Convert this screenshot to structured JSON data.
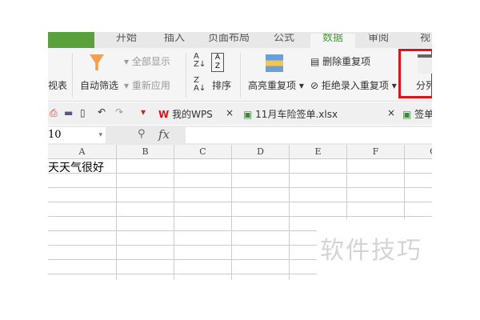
{
  "tabs": [
    "开始",
    "插入",
    "页面布局",
    "公式",
    "数据",
    "审阅",
    "视"
  ],
  "ribbon": {
    "pivot_tail": "视表",
    "autofilter": "自动筛选",
    "show_all": "全部显示",
    "reapply": "重新应用",
    "sort": "排序",
    "highlight_dup": "高亮重复项",
    "remove_dup": "删除重复项",
    "reject_dup": "拒绝录入重复项",
    "split_col": "分列"
  },
  "doc_tabs": [
    {
      "label": "我的WPS"
    },
    {
      "label": "11月车险签单.xlsx"
    },
    {
      "label": "签单"
    }
  ],
  "formula_bar": {
    "name_box": "10",
    "fx": "fx",
    "value": ""
  },
  "columns": [
    "A",
    "B",
    "C",
    "D",
    "E",
    "F",
    "G"
  ],
  "cells": {
    "A1": "天天气很好"
  },
  "watermark": "软件技巧",
  "colors": {
    "accent": "#5aa03c",
    "highlight_box": "#d9141b"
  }
}
